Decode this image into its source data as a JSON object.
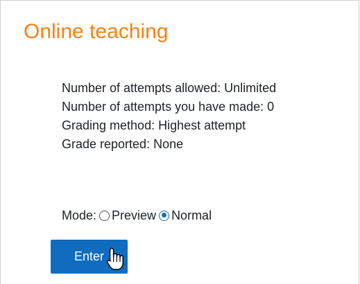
{
  "activity": {
    "title": "Online teaching"
  },
  "info": {
    "attempts_allowed": "Number of attempts allowed: Unlimited",
    "attempts_made": "Number of attempts you have made: 0",
    "grading_method": "Grading method: Highest attempt",
    "grade_reported": "Grade reported: None"
  },
  "mode": {
    "label": "Mode:",
    "options": [
      {
        "label": "Preview",
        "selected": false
      },
      {
        "label": "Normal",
        "selected": true
      }
    ]
  },
  "enter_button": {
    "label": "Enter"
  },
  "icons": {
    "cursor": "hand-pointer-icon"
  },
  "colors": {
    "title": "#f98012",
    "button": "#0f6cbf",
    "radio_selected": "#0f6cbf",
    "text": "#1d2125"
  }
}
